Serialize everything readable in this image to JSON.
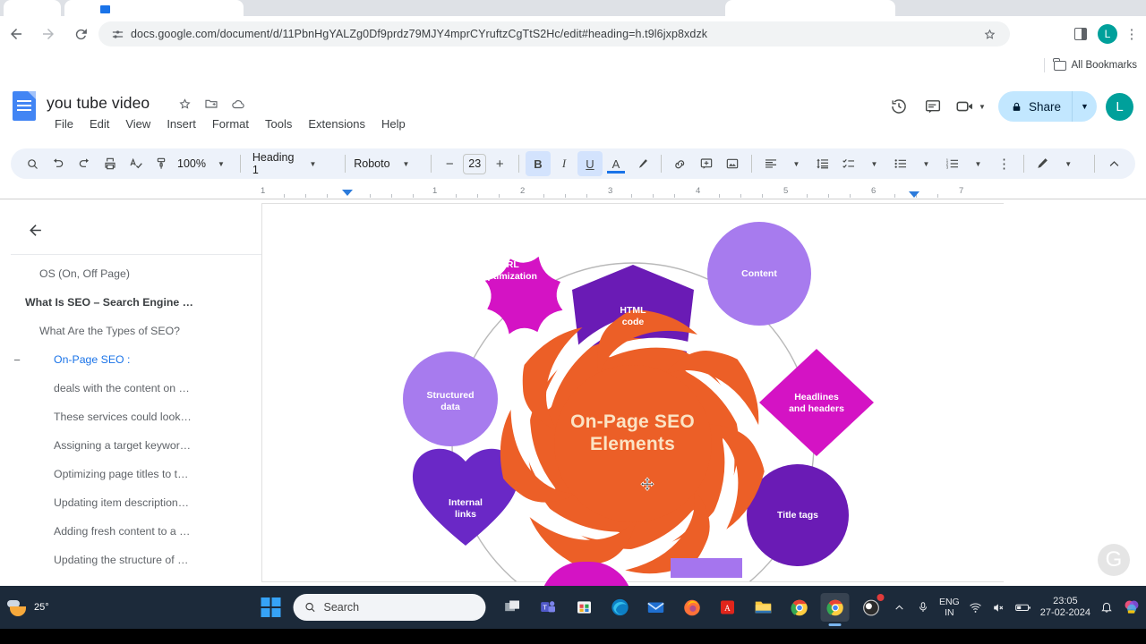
{
  "browser": {
    "url": "docs.google.com/document/d/11PbnHgYALZg0Df9prdz79MJY4mprCYruftzCgTtS2Hc/edit#heading=h.t9l6jxp8xdzk",
    "back_icon": "back-arrow-icon",
    "forward_icon": "forward-arrow-icon",
    "reload_icon": "reload-icon",
    "site_settings_icon": "sliders-icon",
    "bookmark_star_icon": "star-icon",
    "side_panel_icon": "side-panel-icon",
    "menu_icon": "kebab-menu-icon",
    "profile_initial": "L",
    "bookmarks_label": "All Bookmarks"
  },
  "docs": {
    "title": "you tube video",
    "title_icons": [
      "star-icon",
      "move-to-folder-icon",
      "cloud-saved-icon"
    ],
    "menu": [
      "File",
      "Edit",
      "View",
      "Insert",
      "Format",
      "Tools",
      "Extensions",
      "Help"
    ],
    "header_actions": {
      "history_icon": "version-history-icon",
      "comment_icon": "comment-icon",
      "meet_icon": "video-camera-icon",
      "share_label": "Share",
      "share_lock_icon": "lock-icon",
      "avatar_initial": "L"
    },
    "toolbar": {
      "search_icon": "search-icon",
      "undo_icon": "undo-icon",
      "redo_icon": "redo-icon",
      "print_icon": "print-icon",
      "spellcheck_icon": "spellcheck-icon",
      "paint_format_icon": "paint-format-icon",
      "zoom_value": "100%",
      "style_value": "Heading 1",
      "font_value": "Roboto",
      "font_size_value": "23",
      "decrease_label": "−",
      "increase_label": "+",
      "bold_label": "B",
      "italic_label": "I",
      "underline_label": "U",
      "text_color_label": "A",
      "highlight_icon": "highlight-pen-icon",
      "link_icon": "insert-link-icon",
      "comment_icon": "add-comment-icon",
      "image_icon": "insert-image-icon",
      "align_icon": "align-left-icon",
      "line_spacing_icon": "line-spacing-icon",
      "checklist_icon": "checklist-icon",
      "bulleted_list_icon": "bulleted-list-icon",
      "numbered_list_icon": "numbered-list-icon",
      "more_icon": "more-options-icon",
      "editing_mode_icon": "pencil-edit-icon",
      "collapse_icon": "chevron-up-icon"
    },
    "ruler": {
      "marks": [
        "1",
        "1",
        "2",
        "3",
        "4",
        "5",
        "6",
        "7"
      ],
      "left_indent_icon": "indent-marker-icon",
      "right_indent_icon": "indent-marker-icon"
    },
    "outline": {
      "back_icon": "back-arrow-icon",
      "items": [
        {
          "label": "OS (On, Off Page)",
          "level": 1,
          "bold": false,
          "selected": false,
          "collapse": ""
        },
        {
          "label": "What Is SEO – Search Engine …",
          "level": 0,
          "bold": true,
          "selected": false,
          "collapse": ""
        },
        {
          "label": "What Are the Types of SEO?",
          "level": 1,
          "bold": false,
          "selected": false,
          "collapse": ""
        },
        {
          "label": "On-Page SEO :",
          "level": 2,
          "bold": false,
          "selected": true,
          "collapse": "−"
        },
        {
          "label": "deals with the content on …",
          "level": 2,
          "bold": false,
          "selected": false,
          "collapse": ""
        },
        {
          "label": "These services could look…",
          "level": 2,
          "bold": false,
          "selected": false,
          "collapse": ""
        },
        {
          "label": "Assigning a target keywor…",
          "level": 2,
          "bold": false,
          "selected": false,
          "collapse": ""
        },
        {
          "label": "Optimizing page titles to t…",
          "level": 2,
          "bold": false,
          "selected": false,
          "collapse": ""
        },
        {
          "label": "Updating item description…",
          "level": 2,
          "bold": false,
          "selected": false,
          "collapse": ""
        },
        {
          "label": "Adding fresh content to a …",
          "level": 2,
          "bold": false,
          "selected": false,
          "collapse": ""
        },
        {
          "label": "Updating the structure of …",
          "level": 2,
          "bold": false,
          "selected": false,
          "collapse": ""
        }
      ]
    },
    "infographic": {
      "center_line1": "On-Page SEO",
      "center_line2": "Elements",
      "center_color": "#ec5f27",
      "center_text_color": "#fbe3c4",
      "cursor_icon": "move-cursor-icon",
      "nodes": [
        {
          "label": "HTML\ncode",
          "shape": "pentagon",
          "color": "#6a1bb5"
        },
        {
          "label": "Content",
          "shape": "circle",
          "color": "#a77bee"
        },
        {
          "label": "Headlines\nand headers",
          "shape": "diamond",
          "color": "#d413c4"
        },
        {
          "label": "Title tags",
          "shape": "circle",
          "color": "#6a1bb5"
        },
        {
          "label": "Internal\nlinks",
          "shape": "heart",
          "color": "#6a28c6"
        },
        {
          "label": "Structured\ndata",
          "shape": "circle",
          "color": "#a77bee"
        },
        {
          "label": "URL\noptimization",
          "shape": "flower",
          "color": "#d413c4"
        }
      ]
    },
    "watermark": "G"
  },
  "taskbar": {
    "weather_temp": "25°",
    "weather_icon": "partly-cloudy-icon",
    "start_icon": "windows-start-icon",
    "search_placeholder": "Search",
    "search_icon": "search-icon",
    "apps": [
      {
        "name": "task-view-icon",
        "glyph": "❐"
      },
      {
        "name": "microsoft-teams-icon",
        "glyph": "T"
      },
      {
        "name": "microsoft-store-icon",
        "glyph": "⊞"
      },
      {
        "name": "microsoft-edge-icon",
        "glyph": "e"
      },
      {
        "name": "mail-icon",
        "glyph": "✉"
      },
      {
        "name": "firefox-icon",
        "glyph": "●"
      },
      {
        "name": "adobe-acrobat-icon",
        "glyph": "A"
      },
      {
        "name": "file-explorer-icon",
        "glyph": "▬"
      },
      {
        "name": "google-chrome-icon",
        "glyph": "◯"
      },
      {
        "name": "chrome-active-icon",
        "glyph": "◯"
      },
      {
        "name": "obs-studio-icon",
        "glyph": "○"
      }
    ],
    "tray": {
      "show_hidden_icon": "chevron-up-icon",
      "microphone_icon": "microphone-icon",
      "language": "ENG",
      "region": "IN",
      "wifi_icon": "wifi-icon",
      "volume_icon": "volume-muted-icon",
      "battery_icon": "battery-icon",
      "time": "23:05",
      "date": "27-02-2024",
      "notification_icon": "bell-icon",
      "tray_app_icon": "colorful-app-icon"
    }
  }
}
